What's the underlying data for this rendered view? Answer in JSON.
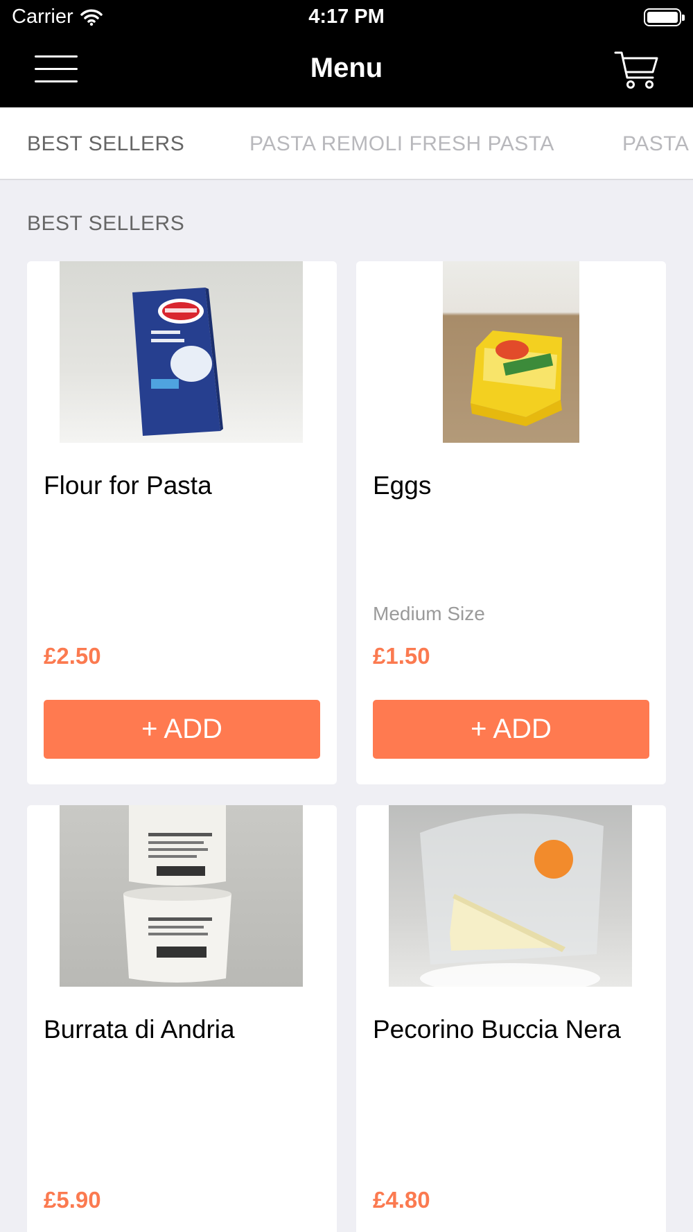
{
  "status_bar": {
    "carrier": "Carrier",
    "time": "4:17 PM"
  },
  "nav": {
    "title": "Menu"
  },
  "tabs": [
    {
      "label": "BEST SELLERS",
      "active": true
    },
    {
      "label": "PASTA REMOLI FRESH PASTA",
      "active": false
    },
    {
      "label": "PASTA",
      "active": false
    }
  ],
  "section": {
    "title": "BEST SELLERS"
  },
  "products": [
    {
      "name": "Flour for Pasta",
      "description": "",
      "price": "£2.50",
      "button": "+ ADD"
    },
    {
      "name": "Eggs",
      "description": "Medium Size",
      "price": "£1.50",
      "button": "+ ADD"
    },
    {
      "name": "Burrata di Andria",
      "description": "",
      "price": "£5.90"
    },
    {
      "name": "Pecorino Buccia Nera",
      "description": "",
      "price": "£4.80"
    }
  ],
  "colors": {
    "accent": "#ff7a50",
    "header": "#000000",
    "background": "#efeff4"
  }
}
